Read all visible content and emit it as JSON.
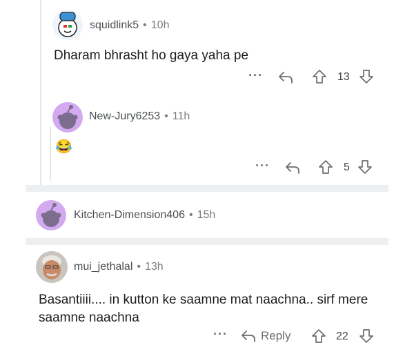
{
  "comments": [
    {
      "username": "squidlink5",
      "time": "10h",
      "text": "Dharam bhrasht ho gaya yaha pe",
      "votes": "13",
      "more": "···"
    },
    {
      "username": "New-Jury6253",
      "time": "11h",
      "text": "😂",
      "votes": "5",
      "more": "···"
    },
    {
      "username": "Kitchen-Dimension406",
      "time": "15h"
    },
    {
      "username": "mui_jethalal",
      "time": "13h",
      "text": "Basantiiii.... in kutton ke saamne mat naachna.. sirf mere saamne naachna",
      "votes": "22",
      "more": "···",
      "reply_label": "Reply"
    }
  ],
  "separator": "•",
  "colors": {
    "avatar_purple": "#d3a9ef",
    "snoo_gray": "#7c6d8e",
    "divider": "#edeff1",
    "action_gray": "#6a6d70"
  },
  "icons": [
    "reply-arrow-icon",
    "upvote-icon",
    "downvote-icon",
    "more-icon"
  ]
}
